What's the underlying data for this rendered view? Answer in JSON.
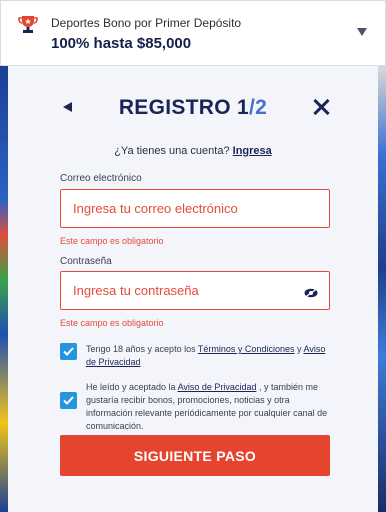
{
  "banner": {
    "subtitle": "Deportes Bono por Primer Depósito",
    "title": "100% hasta $85,000",
    "icon": "trophy-icon",
    "chevron_icon": "chevron-down-icon"
  },
  "modal": {
    "title_main": "REGISTRO 1",
    "title_slash_total": "/2",
    "back_icon": "back-arrow-icon",
    "close_icon": "close-icon",
    "have_account_prefix": "¿Ya tienes una cuenta? ",
    "have_account_link": "Ingresa"
  },
  "form": {
    "email": {
      "label": "Correo electrónico",
      "value": "",
      "placeholder": "Ingresa tu correo electrónico",
      "error": "Este campo es obligatorio"
    },
    "password": {
      "label": "Contraseña",
      "value": "",
      "placeholder": "Ingresa tu contraseña",
      "error": "Este campo es obligatorio",
      "toggle_icon": "eye-icon"
    },
    "consent_terms": {
      "checked": true,
      "text_1": "Tengo 18 años y acepto los ",
      "link_1": "Términos y Condiciones",
      "text_2": " y ",
      "link_2": "Aviso de Privacidad"
    },
    "consent_marketing": {
      "checked": true,
      "text_1": "He leído y aceptado la ",
      "link_1": "Aviso de Privacidad",
      "text_2": " , y también me gustaría recibir bonos, promociones, noticias y otra información relevante periódicamente por cualquier canal de comunicación."
    },
    "submit_label": "SIGUIENTE PASO"
  },
  "colors": {
    "accent": "#e5452f",
    "checkbox": "#2596de",
    "navy": "#1a2456",
    "error": "#e54b3a"
  }
}
